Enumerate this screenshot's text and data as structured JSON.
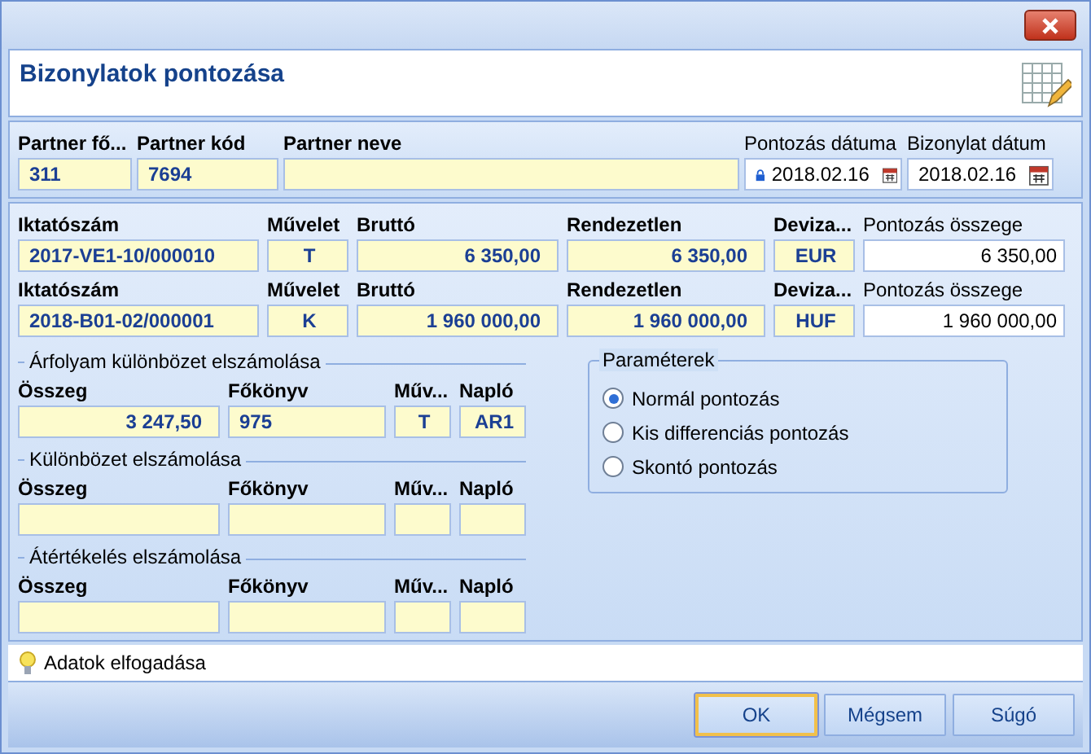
{
  "window": {
    "title": "Bizonylatok pontozása"
  },
  "partner": [
    {
      "label": "Partner fő...",
      "value": "311",
      "kind": "text"
    },
    {
      "label": "Partner kód",
      "value": "7694",
      "kind": "text"
    },
    {
      "label": "Partner neve",
      "kind": "text"
    },
    {
      "label": "Pontozás dátuma",
      "value": "2018.02.16",
      "kind": "locked-date"
    },
    {
      "label": "Bizonylat dátum",
      "value": "2018.02.16",
      "kind": "date"
    }
  ],
  "documents": [
    {
      "fields": [
        {
          "label": "Iktatószám",
          "value": "2017-VE1-10/000010",
          "kind": "text"
        },
        {
          "label": "Művelet",
          "value": "T",
          "kind": "code"
        },
        {
          "label": "Bruttó",
          "value": "6 350,00",
          "kind": "amount"
        },
        {
          "label": "Rendezetlen",
          "value": "6 350,00",
          "kind": "amount"
        },
        {
          "label": "Deviza...",
          "value": "EUR",
          "kind": "code"
        },
        {
          "label": "Pontozás összege",
          "value": "6 350,00",
          "kind": "input"
        }
      ]
    },
    {
      "fields": [
        {
          "label": "Iktatószám",
          "value": "2018-B01-02/000001",
          "kind": "text"
        },
        {
          "label": "Művelet",
          "value": "K",
          "kind": "code"
        },
        {
          "label": "Bruttó",
          "value": "1 960 000,00",
          "kind": "amount"
        },
        {
          "label": "Rendezetlen",
          "value": "1 960 000,00",
          "kind": "amount"
        },
        {
          "label": "Deviza...",
          "value": "HUF",
          "kind": "code"
        },
        {
          "label": "Pontozás összege",
          "value": "1 960 000,00",
          "kind": "input"
        }
      ]
    }
  ],
  "sections": [
    {
      "title": "Árfolyam különbözet elszámolása",
      "fields": [
        {
          "label": "Összeg",
          "value": "3 247,50",
          "kind": "amount"
        },
        {
          "label": "Főkönyv",
          "value": "975",
          "kind": "text"
        },
        {
          "label": "Műv...",
          "value": "T",
          "kind": "code"
        },
        {
          "label": "Napló",
          "value": "AR1",
          "kind": "code"
        }
      ]
    },
    {
      "title": "Különbözet elszámolása",
      "fields": [
        {
          "label": "Összeg",
          "kind": "amount"
        },
        {
          "label": "Főkönyv",
          "kind": "text"
        },
        {
          "label": "Műv...",
          "kind": "code"
        },
        {
          "label": "Napló",
          "kind": "code"
        }
      ]
    },
    {
      "title": "Átértékelés elszámolása",
      "fields": [
        {
          "label": "Összeg",
          "kind": "amount"
        },
        {
          "label": "Főkönyv",
          "kind": "text"
        },
        {
          "label": "Műv...",
          "kind": "code"
        },
        {
          "label": "Napló",
          "kind": "code"
        }
      ]
    }
  ],
  "parameters": {
    "title": "Paraméterek",
    "options": [
      {
        "label": "Normál pontozás",
        "selected": true
      },
      {
        "label": "Kis differenciás pontozás",
        "selected": false
      },
      {
        "label": "Skontó pontozás",
        "selected": false
      }
    ]
  },
  "status_bar": {
    "hint": "Adatok elfogadása"
  },
  "buttons": [
    {
      "label": "OK",
      "focused": true
    },
    {
      "label": "Mégsem",
      "focused": false
    },
    {
      "label": "Súgó",
      "focused": false
    }
  ]
}
